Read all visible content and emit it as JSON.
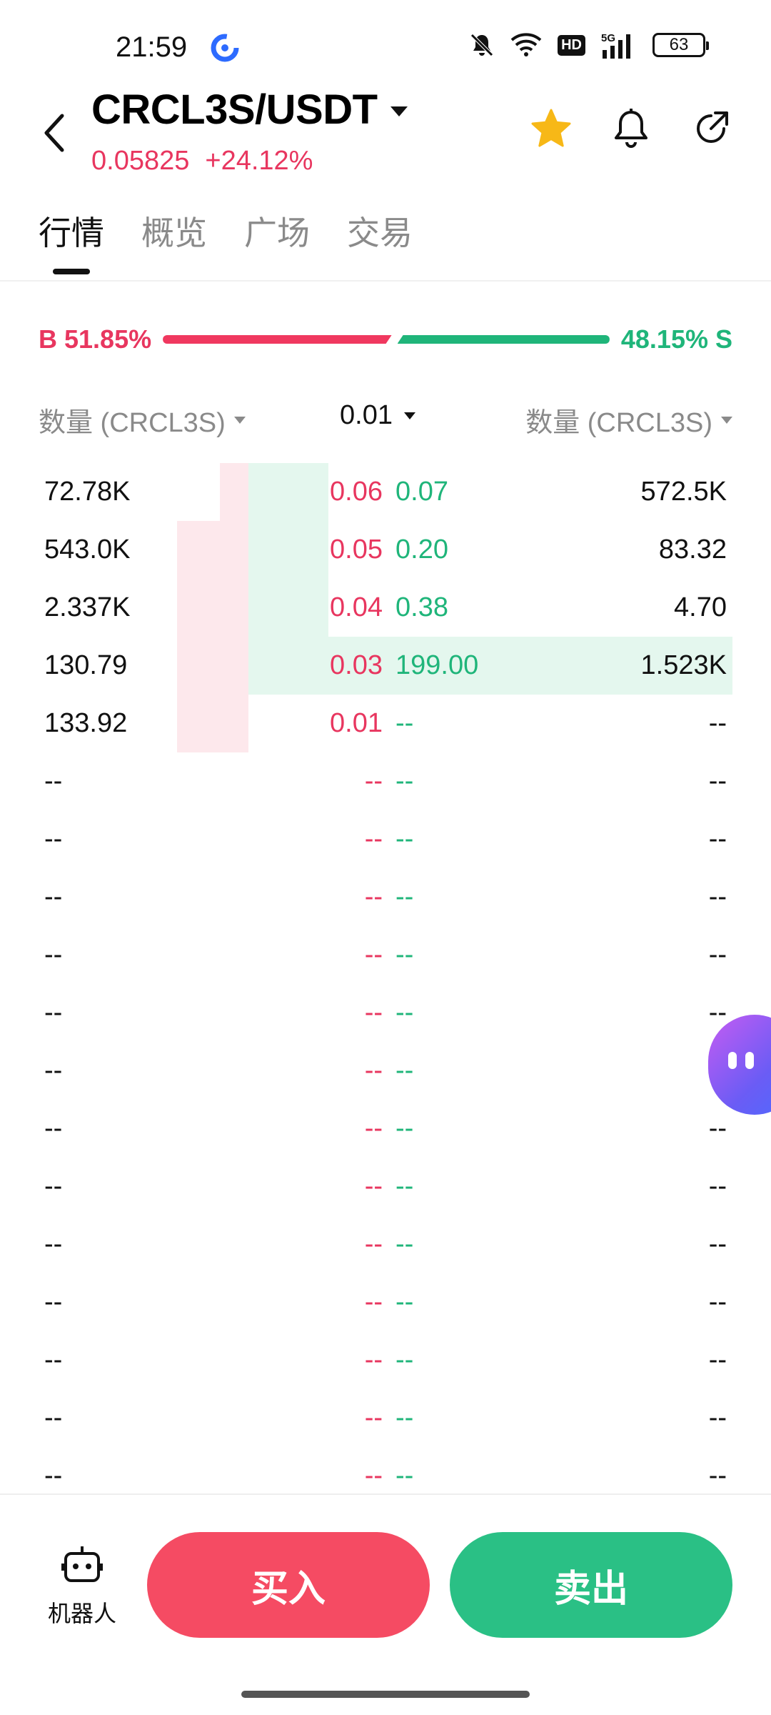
{
  "status_bar": {
    "time": "21:59",
    "network": "5G",
    "hd": "HD",
    "battery": "63",
    "icons": [
      "app-logo-icon",
      "mute-bell-icon",
      "wifi-icon",
      "hd-icon",
      "signal-icon",
      "battery-icon"
    ]
  },
  "header": {
    "pair": "CRCL3S/USDT",
    "price": "0.05825",
    "change": "+24.12%",
    "icons": [
      "back-icon",
      "favorite-star-icon",
      "alert-bell-icon",
      "share-icon"
    ]
  },
  "tabs": [
    {
      "label": "行情",
      "active": true
    },
    {
      "label": "概览",
      "active": false
    },
    {
      "label": "广场",
      "active": false
    },
    {
      "label": "交易",
      "active": false
    }
  ],
  "ratio": {
    "buy_label": "B 51.85%",
    "sell_label": "48.15% S",
    "buy_pct": 51.85,
    "sell_pct": 48.15
  },
  "book_header": {
    "bid_qty": "数量 (CRCL3S)",
    "precision": "0.01",
    "ask_qty": "数量 (CRCL3S)"
  },
  "order_book": [
    {
      "bid_qty": "72.78K",
      "bid_price": "0.06",
      "ask_price": "0.07",
      "ask_qty": "572.5K"
    },
    {
      "bid_qty": "543.0K",
      "bid_price": "0.05",
      "ask_price": "0.20",
      "ask_qty": "83.32"
    },
    {
      "bid_qty": "2.337K",
      "bid_price": "0.04",
      "ask_price": "0.38",
      "ask_qty": "4.70"
    },
    {
      "bid_qty": "130.79",
      "bid_price": "0.03",
      "ask_price": "199.00",
      "ask_qty": "1.523K"
    },
    {
      "bid_qty": "133.92",
      "bid_price": "0.01",
      "ask_price": "--",
      "ask_qty": "--"
    },
    {
      "bid_qty": "--",
      "bid_price": "--",
      "ask_price": "--",
      "ask_qty": "--"
    },
    {
      "bid_qty": "--",
      "bid_price": "--",
      "ask_price": "--",
      "ask_qty": "--"
    },
    {
      "bid_qty": "--",
      "bid_price": "--",
      "ask_price": "--",
      "ask_qty": "--"
    },
    {
      "bid_qty": "--",
      "bid_price": "--",
      "ask_price": "--",
      "ask_qty": "--"
    },
    {
      "bid_qty": "--",
      "bid_price": "--",
      "ask_price": "--",
      "ask_qty": "--"
    },
    {
      "bid_qty": "--",
      "bid_price": "--",
      "ask_price": "--",
      "ask_qty": "--"
    },
    {
      "bid_qty": "--",
      "bid_price": "--",
      "ask_price": "--",
      "ask_qty": "--"
    },
    {
      "bid_qty": "--",
      "bid_price": "--",
      "ask_price": "--",
      "ask_qty": "--"
    },
    {
      "bid_qty": "--",
      "bid_price": "--",
      "ask_price": "--",
      "ask_qty": "--"
    },
    {
      "bid_qty": "--",
      "bid_price": "--",
      "ask_price": "--",
      "ask_qty": "--"
    },
    {
      "bid_qty": "--",
      "bid_price": "--",
      "ask_price": "--",
      "ask_qty": "--"
    },
    {
      "bid_qty": "--",
      "bid_price": "--",
      "ask_price": "--",
      "ask_qty": "--"
    },
    {
      "bid_qty": "--",
      "bid_price": "--",
      "ask_price": "--",
      "ask_qty": "--"
    }
  ],
  "depth": {
    "bid_fill": [
      0.26,
      0.65,
      0.65,
      0.65,
      0.65
    ],
    "ask_fill": [
      0.55,
      0.55,
      0.55,
      1.0,
      0
    ]
  },
  "bottom": {
    "robot_label": "机器人",
    "buy_label": "买入",
    "sell_label": "卖出"
  },
  "colors": {
    "buy": "#f54b63",
    "sell": "#2ac085",
    "price_up": "#e8365f"
  }
}
